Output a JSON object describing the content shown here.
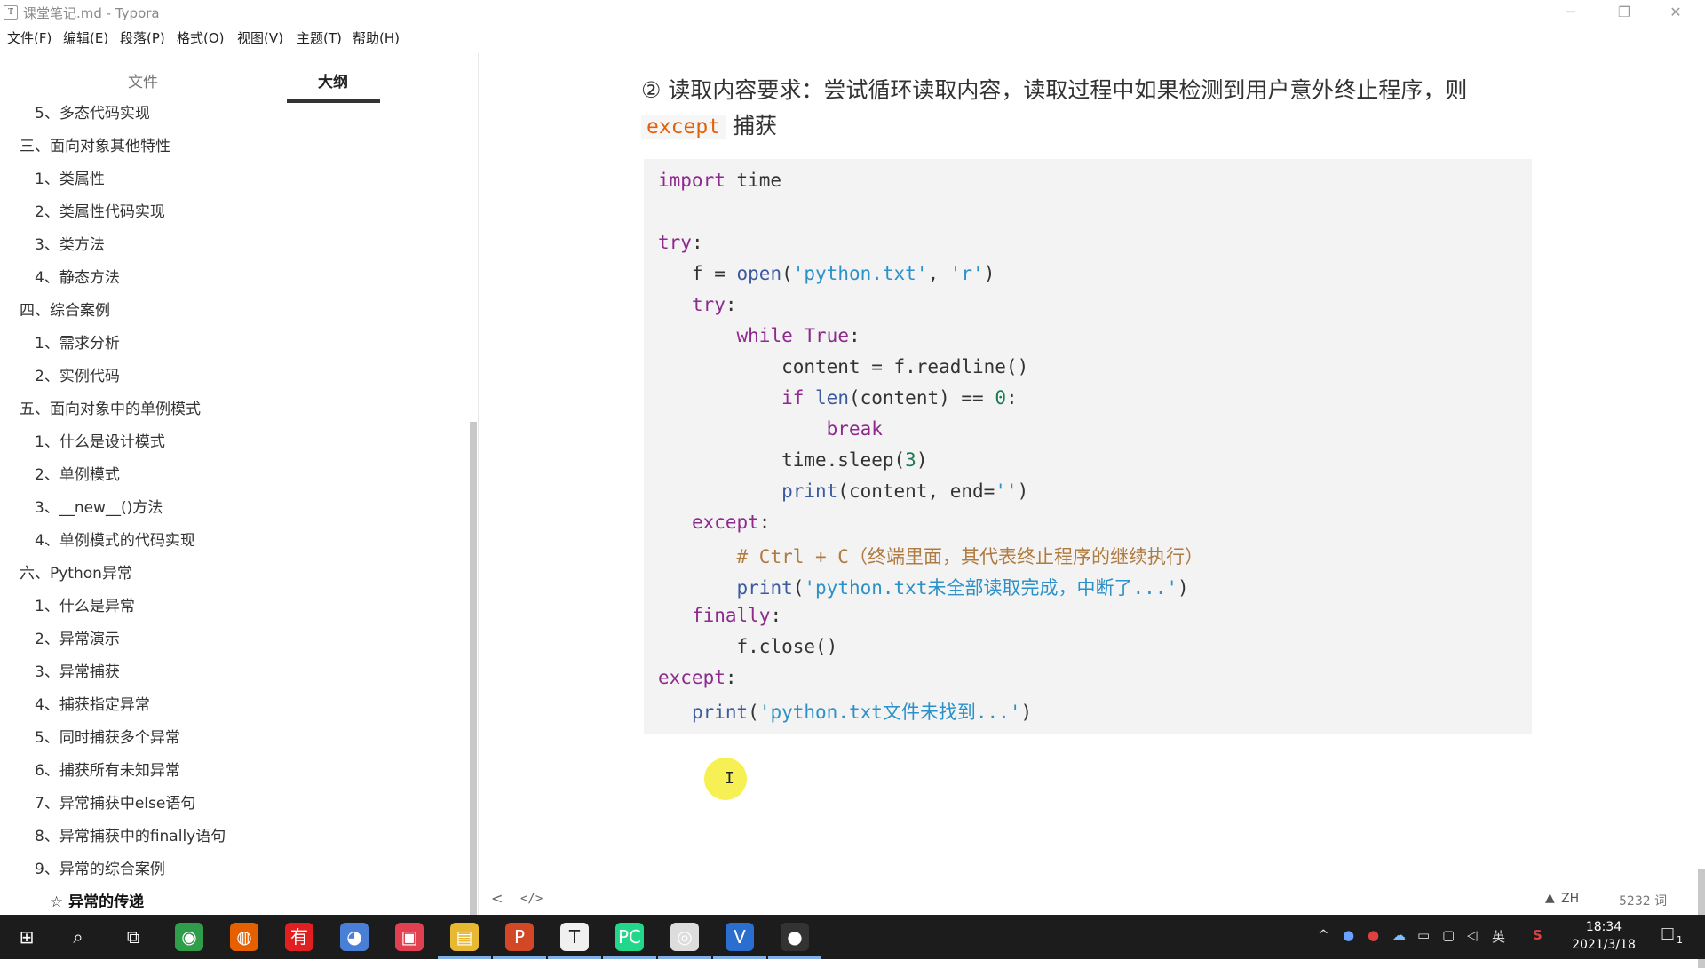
{
  "window": {
    "title": "课堂笔记.md - Typora",
    "app_icon": "T",
    "minimize": "─",
    "restore": "❐",
    "close": "✕"
  },
  "menu": [
    "文件(F)",
    "编辑(E)",
    "段落(P)",
    "格式(O)",
    "视图(V)",
    "主题(T)",
    "帮助(H)"
  ],
  "sidebar": {
    "tabs": [
      "文件",
      "大纲"
    ],
    "active_tab": "大纲",
    "outline": [
      {
        "label": "5、多态代码实现",
        "level": 2
      },
      {
        "label": "三、面向对象其他特性",
        "level": 1
      },
      {
        "label": "1、类属性",
        "level": 2
      },
      {
        "label": "2、类属性代码实现",
        "level": 2
      },
      {
        "label": "3、类方法",
        "level": 2
      },
      {
        "label": "4、静态方法",
        "level": 2
      },
      {
        "label": "四、综合案例",
        "level": 1
      },
      {
        "label": "1、需求分析",
        "level": 2
      },
      {
        "label": "2、实例代码",
        "level": 2
      },
      {
        "label": "五、面向对象中的单例模式",
        "level": 1
      },
      {
        "label": "1、什么是设计模式",
        "level": 2
      },
      {
        "label": "2、单例模式",
        "level": 2
      },
      {
        "label": "3、__new__()方法",
        "level": 2
      },
      {
        "label": "4、单例模式的代码实现",
        "level": 2
      },
      {
        "label": "六、Python异常",
        "level": 1
      },
      {
        "label": "1、什么是异常",
        "level": 2
      },
      {
        "label": "2、异常演示",
        "level": 2
      },
      {
        "label": "3、异常捕获",
        "level": 2
      },
      {
        "label": "4、捕获指定异常",
        "level": 2
      },
      {
        "label": "5、同时捕获多个异常",
        "level": 2
      },
      {
        "label": "6、捕获所有未知异常",
        "level": 2
      },
      {
        "label": "7、异常捕获中else语句",
        "level": 2
      },
      {
        "label": "8、异常捕获中的finally语句",
        "level": 2
      },
      {
        "label": "9、异常的综合案例",
        "level": 2
      },
      {
        "label": "☆ 异常的传递",
        "level": 3,
        "active": true
      }
    ]
  },
  "content": {
    "heading_text": "② 读取内容要求：尝试循环读取内容，读取过程中如果检测到用户意外终止程序，则",
    "heading_code": "except",
    "heading_suffix": " 捕获",
    "code_lines": [
      [
        {
          "t": "import",
          "c": "kw"
        },
        {
          "t": " time",
          "c": ""
        }
      ],
      [],
      [
        {
          "t": "try",
          "c": "kw"
        },
        {
          "t": ":",
          "c": ""
        }
      ],
      [
        {
          "t": "   f = ",
          "c": ""
        },
        {
          "t": "open",
          "c": "fn"
        },
        {
          "t": "(",
          "c": ""
        },
        {
          "t": "'python.txt'",
          "c": "str"
        },
        {
          "t": ", ",
          "c": ""
        },
        {
          "t": "'r'",
          "c": "str"
        },
        {
          "t": ")",
          "c": ""
        }
      ],
      [
        {
          "t": "   ",
          "c": ""
        },
        {
          "t": "try",
          "c": "kw"
        },
        {
          "t": ":",
          "c": ""
        }
      ],
      [
        {
          "t": "       ",
          "c": ""
        },
        {
          "t": "while",
          "c": "kw"
        },
        {
          "t": " ",
          "c": ""
        },
        {
          "t": "True",
          "c": "kw"
        },
        {
          "t": ":",
          "c": ""
        }
      ],
      [
        {
          "t": "           content = f.readline()",
          "c": ""
        }
      ],
      [
        {
          "t": "           ",
          "c": ""
        },
        {
          "t": "if",
          "c": "kw"
        },
        {
          "t": " ",
          "c": ""
        },
        {
          "t": "len",
          "c": "fn"
        },
        {
          "t": "(content) == ",
          "c": ""
        },
        {
          "t": "0",
          "c": "num"
        },
        {
          "t": ":",
          "c": ""
        }
      ],
      [
        {
          "t": "               ",
          "c": ""
        },
        {
          "t": "break",
          "c": "kw"
        }
      ],
      [
        {
          "t": "           time.sleep(",
          "c": ""
        },
        {
          "t": "3",
          "c": "num"
        },
        {
          "t": ")",
          "c": ""
        }
      ],
      [
        {
          "t": "           ",
          "c": ""
        },
        {
          "t": "print",
          "c": "fn"
        },
        {
          "t": "(content, end=",
          "c": ""
        },
        {
          "t": "''",
          "c": "str"
        },
        {
          "t": ")",
          "c": ""
        }
      ],
      [
        {
          "t": "   ",
          "c": ""
        },
        {
          "t": "except",
          "c": "kw"
        },
        {
          "t": ":",
          "c": ""
        }
      ],
      [
        {
          "t": "       ",
          "c": ""
        },
        {
          "t": "# Ctrl + C（终端里面，其代表终止程序的继续执行）",
          "c": "cm"
        }
      ],
      [
        {
          "t": "       ",
          "c": ""
        },
        {
          "t": "print",
          "c": "fn"
        },
        {
          "t": "(",
          "c": ""
        },
        {
          "t": "'python.txt未全部读取完成，中断了...'",
          "c": "str"
        },
        {
          "t": ")",
          "c": ""
        }
      ],
      [
        {
          "t": "   ",
          "c": ""
        },
        {
          "t": "finally",
          "c": "kw"
        },
        {
          "t": ":",
          "c": ""
        }
      ],
      [
        {
          "t": "       f.close()",
          "c": ""
        }
      ],
      [
        {
          "t": "except",
          "c": "kw"
        },
        {
          "t": ":",
          "c": ""
        }
      ],
      [
        {
          "t": "   ",
          "c": ""
        },
        {
          "t": "print",
          "c": "fn"
        },
        {
          "t": "(",
          "c": ""
        },
        {
          "t": "'python.txt文件未找到...'",
          "c": "str"
        },
        {
          "t": ")",
          "c": ""
        }
      ]
    ]
  },
  "statusbar": {
    "back_button": "<",
    "source_toggle": "</>",
    "lang": "ZH",
    "word_count": "5232 词"
  },
  "taskbar": {
    "apps": [
      {
        "name": "start",
        "glyph": "⊞",
        "color": "#1c1c1c"
      },
      {
        "name": "search",
        "glyph": "⌕",
        "color": "#1c1c1c"
      },
      {
        "name": "task-view",
        "glyph": "⧉",
        "color": "#1c1c1c"
      },
      {
        "name": "chrome",
        "glyph": "◉",
        "color": "#2f9d4a"
      },
      {
        "name": "firefox",
        "glyph": "◍",
        "color": "#e66000"
      },
      {
        "name": "youdao",
        "glyph": "有",
        "color": "#e02020"
      },
      {
        "name": "browser",
        "glyph": "◕",
        "color": "#4a7fd8"
      },
      {
        "name": "screen-recorder",
        "glyph": "▣",
        "color": "#e04050"
      },
      {
        "name": "file-explorer",
        "glyph": "▤",
        "color": "#e8b830"
      },
      {
        "name": "powerpoint",
        "glyph": "P",
        "color": "#d24726"
      },
      {
        "name": "typora",
        "glyph": "T",
        "color": "#f0f0f0"
      },
      {
        "name": "pycharm",
        "glyph": "PC",
        "color": "#21d789"
      },
      {
        "name": "obs",
        "glyph": "◎",
        "color": "#dddddd"
      },
      {
        "name": "vscode-like",
        "glyph": "V",
        "color": "#2a6fd0"
      },
      {
        "name": "recorder",
        "glyph": "●",
        "color": "#333333"
      }
    ],
    "tray": {
      "chevron": "^",
      "ime": "英",
      "time": "18:34",
      "date": "2021/3/18",
      "notification_count": "1"
    }
  }
}
